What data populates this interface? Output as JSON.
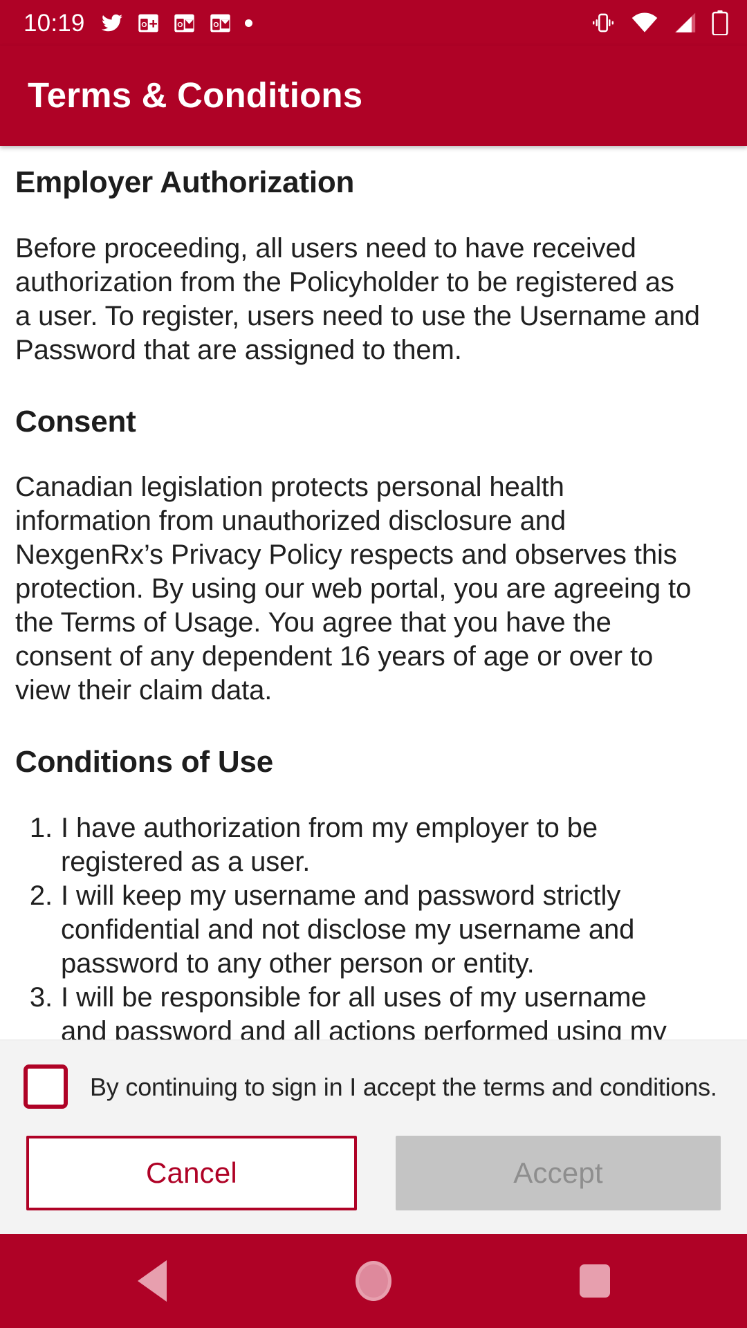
{
  "status_bar": {
    "time": "10:19",
    "left_icons": [
      "twitter-icon",
      "outlook-calendar-icon",
      "outlook-mail-icon",
      "outlook-mail-icon",
      "dot-icon"
    ],
    "right_icons": [
      "vibrate-icon",
      "wifi-icon",
      "cellular-signal-icon",
      "battery-charging-icon"
    ]
  },
  "app_bar": {
    "title": "Terms & Conditions",
    "background_color": "#AF0226"
  },
  "content": {
    "sections": [
      {
        "heading": "Employer Authorization",
        "paragraph_lines": [
          "Before proceeding, all users need to have received",
          "authorization from the Policyholder to be registered as",
          "a user. To register, users need to use the Username and",
          "Password that are assigned to them."
        ],
        "paragraph": "Before proceeding, all users need to have received authorization from the Policyholder to be registered as a user. To register, users need to use the Username and Password that are assigned to them."
      },
      {
        "heading": "Consent",
        "paragraph_lines": [
          "Canadian legislation protects personal health",
          "information from unauthorized disclosure and",
          "NexgenRx’s Privacy Policy respects and observes this",
          "protection. By using our web portal, you are agreeing to",
          "the Terms of Usage. You agree that you have the",
          "consent of any dependent 16 years of age or over to",
          "view their claim data."
        ],
        "paragraph": "Canadian legislation protects personal health information from unauthorized disclosure and NexgenRx’s Privacy Policy respects and observes this protection. By using our web portal, you are agreeing to the Terms of Usage. You agree that you have the consent of any dependent 16 years of age or over to view their claim data."
      },
      {
        "heading": "Conditions of Use"
      }
    ],
    "conditions_list": [
      {
        "number": "1.",
        "lines": [
          "I have authorization from my employer to be",
          "registered as a user."
        ],
        "text": "I have authorization from my employer to be registered as a user."
      },
      {
        "number": "2.",
        "lines": [
          "I will keep my username and password strictly",
          "confidential and not disclose my username and",
          "password to any other person or entity."
        ],
        "text": "I will keep my username and password strictly confidential and not disclose my username and password to any other person or entity."
      },
      {
        "number": "3.",
        "lines": [
          "I will be responsible for all uses of my username",
          "and password and all actions performed using my"
        ],
        "text": "I will be responsible for all uses of my username and password and all actions performed using my"
      }
    ]
  },
  "bottom_panel": {
    "accept_checkbox_label": "By continuing to sign in I accept the terms and conditions.",
    "accept_checkbox_checked": false,
    "cancel_button_label": "Cancel",
    "accept_button_label": "Accept",
    "accept_button_enabled": false,
    "accent_color": "#AF0226",
    "disabled_button_color": "#C4C4C4"
  },
  "nav_bar": {
    "buttons": [
      "back-button",
      "home-button",
      "recents-button"
    ]
  }
}
